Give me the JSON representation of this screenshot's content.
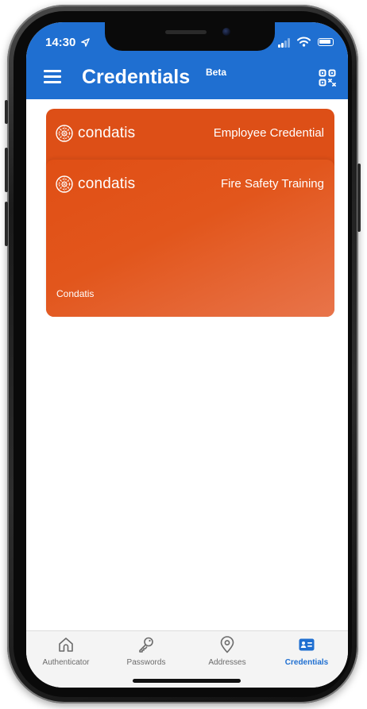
{
  "status_bar": {
    "time": "14:30"
  },
  "header": {
    "title": "Credentials",
    "badge": "Beta",
    "menu_icon": "hamburger-menu-icon",
    "qr_icon": "qr-code-icon",
    "color": "#1f6fd1"
  },
  "credentials": [
    {
      "brand": "condatis",
      "title": "Employee Credential",
      "color": "#dd4f17"
    },
    {
      "brand": "condatis",
      "title": "Fire Safety Training",
      "issuer": "Condatis",
      "color": "#e2561c"
    }
  ],
  "tabs": [
    {
      "label": "Authenticator",
      "icon": "home-icon",
      "active": false
    },
    {
      "label": "Passwords",
      "icon": "key-icon",
      "active": false
    },
    {
      "label": "Addresses",
      "icon": "location-pin-icon",
      "active": false
    },
    {
      "label": "Credentials",
      "icon": "id-card-icon",
      "active": true
    }
  ],
  "colors": {
    "accent": "#1f6fd1",
    "card": "#e2561c",
    "tab_inactive": "#6b6b6b"
  }
}
